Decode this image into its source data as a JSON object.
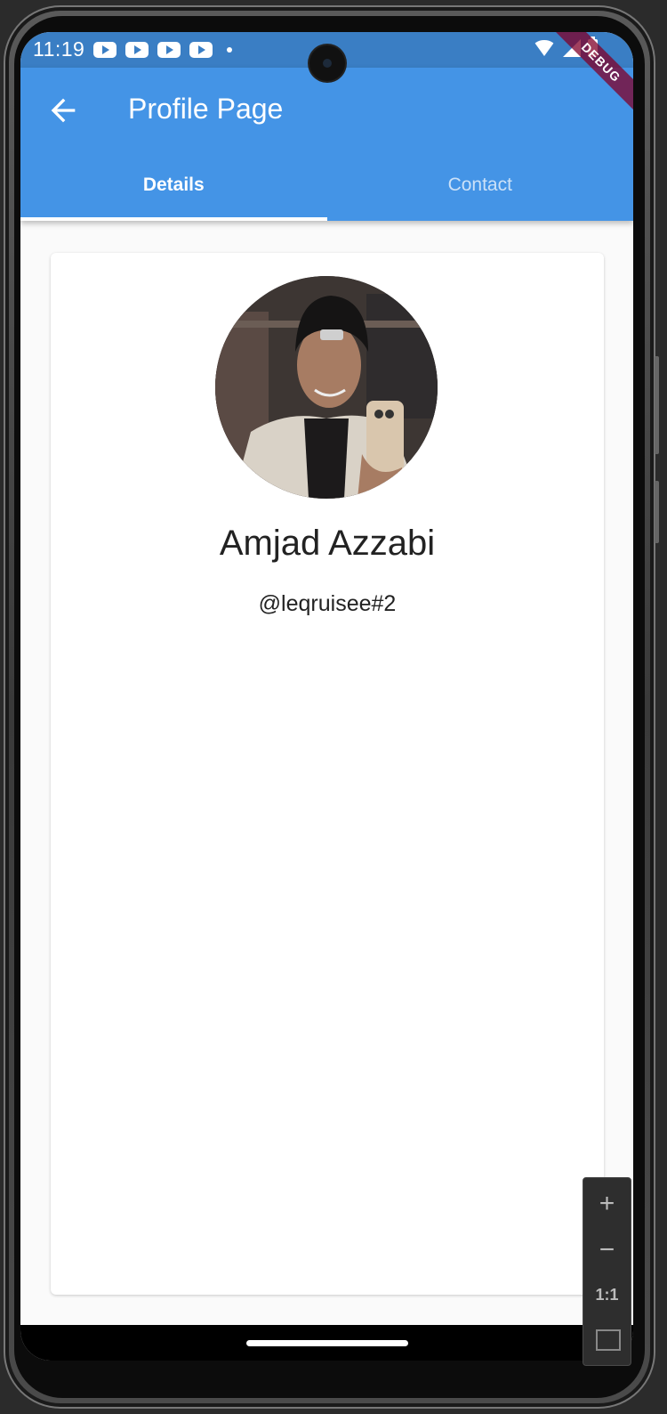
{
  "status_bar": {
    "time": "11:19",
    "icons": [
      "youtube-icon",
      "youtube-icon",
      "youtube-icon",
      "youtube-icon",
      "dot-icon",
      "wifi-icon",
      "signal-icon",
      "battery-icon"
    ]
  },
  "debug_banner": "DEBUG",
  "app_bar": {
    "title": "Profile Page",
    "back_icon": "arrow-back-icon",
    "background": "#4494e6"
  },
  "tabs": [
    {
      "label": "Details",
      "active": true
    },
    {
      "label": "Contact",
      "active": false
    }
  ],
  "profile": {
    "name": "Amjad Azzabi",
    "handle": "@leqruisee#2"
  },
  "zoom_controls": {
    "zoom_in": "+",
    "zoom_out": "−",
    "actual_size": "1:1",
    "fit_icon": "fit-screen-icon"
  }
}
